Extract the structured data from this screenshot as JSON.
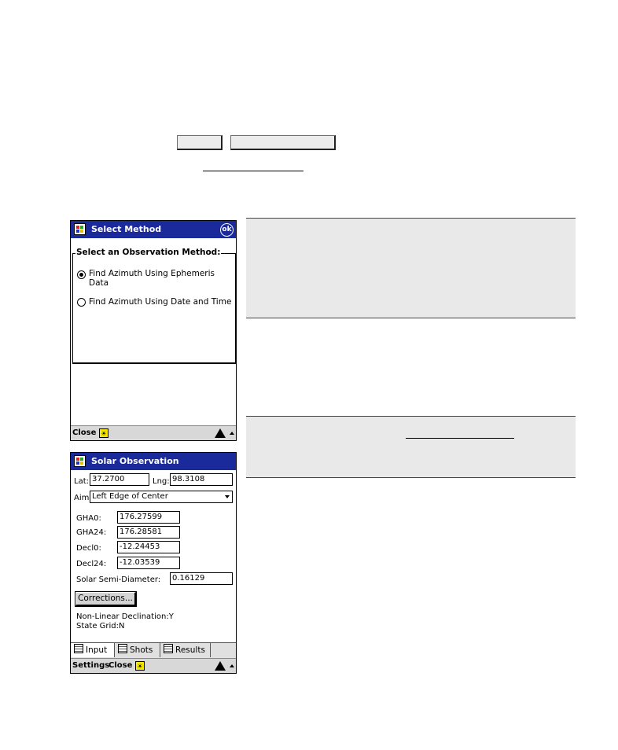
{
  "colors": {
    "titlebar": "#1a2a9a",
    "panel": "#e9e9e9",
    "bottombar": "#d8d8d8",
    "sun": "#f3e600"
  },
  "select_method": {
    "title": "Select Method",
    "ok_label": "ok",
    "group_label": "Select an Observation Method:",
    "options": [
      {
        "label": "Find Azimuth Using Ephemeris Data",
        "selected": true
      },
      {
        "label": "Find Azimuth Using Date and Time",
        "selected": false
      }
    ],
    "close_label": "Close"
  },
  "solar_observation": {
    "title": "Solar Observation",
    "lat_label": "Lat:",
    "lat_value": "37.2700",
    "lng_label": "Lng:",
    "lng_value": "98.3108",
    "aim_label": "Aim:",
    "aim_value": "Left Edge of Center",
    "gha0_label": "GHA0:",
    "gha0_value": "176.27599",
    "gha24_label": "GHA24:",
    "gha24_value": "176.28581",
    "decl0_label": "Decl0:",
    "decl0_value": "-12.24453",
    "decl24_label": "Decl24:",
    "decl24_value": "-12.03539",
    "semi_label": "Solar Semi-Diameter:",
    "semi_value": "0.16129",
    "corrections_label": "Corrections...",
    "nonlinear_text": "Non-Linear Declination:Y",
    "stategrid_text": "State Grid:N",
    "tabs": [
      "Input",
      "Shots",
      "Results"
    ],
    "settings_label": "Settings",
    "close_label": "Close"
  },
  "icons": [
    "windows-logo-icon",
    "sun-icon",
    "warning-icon",
    "up-arrow-icon",
    "dropdown-arrow-icon"
  ]
}
